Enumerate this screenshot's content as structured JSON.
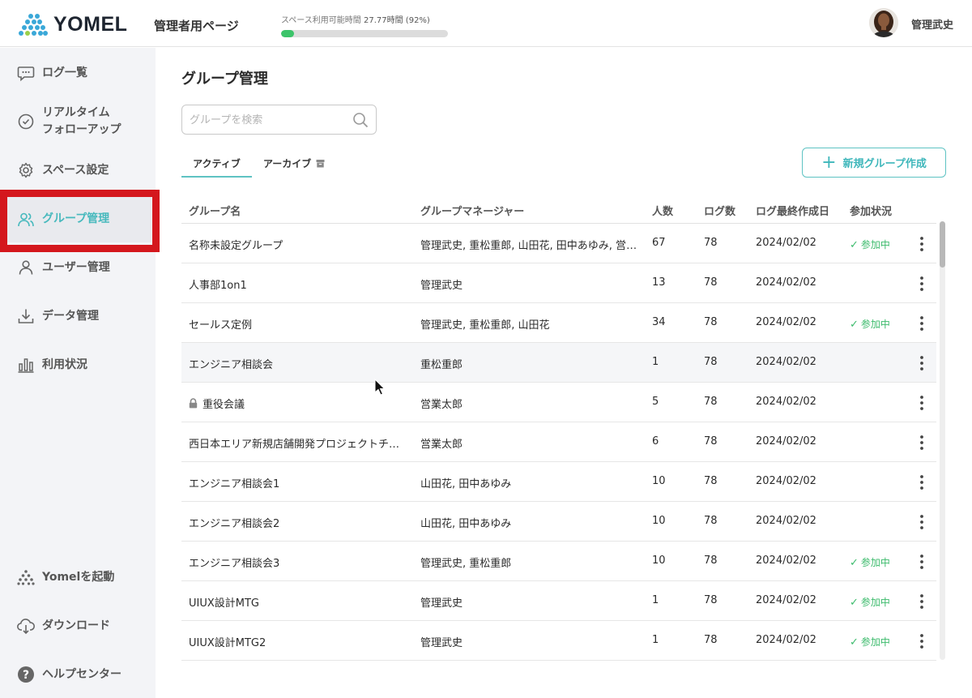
{
  "header": {
    "logo_text": "YOMEL",
    "admin_title": "管理者用ページ",
    "quota_label": "スペース利用可能時間",
    "quota_value": "27.77時間 (92%)",
    "quota_percent": 0.08,
    "user_name": "管理武史"
  },
  "sidebar": {
    "items": [
      {
        "label": "ログ一覧",
        "icon": "chat-bubble-icon"
      },
      {
        "label": "リアルタイム\nフォローアップ",
        "icon": "clock-icon"
      },
      {
        "label": "スペース設定",
        "icon": "gear-icon"
      },
      {
        "label": "グループ管理",
        "icon": "group-icon",
        "active": true
      },
      {
        "label": "ユーザー管理",
        "icon": "user-icon"
      },
      {
        "label": "データ管理",
        "icon": "download-tray-icon"
      },
      {
        "label": "利用状況",
        "icon": "bar-chart-icon"
      }
    ],
    "bottom_items": [
      {
        "label": "Yomelを起動",
        "icon": "yomel-logo-icon"
      },
      {
        "label": "ダウンロード",
        "icon": "cloud-download-icon"
      },
      {
        "label": "ヘルプセンター",
        "icon": "help-icon"
      }
    ]
  },
  "main": {
    "title": "グループ管理",
    "search_placeholder": "グループを検索",
    "tabs": [
      {
        "label": "アクティブ"
      },
      {
        "label": "アーカイブ"
      }
    ],
    "new_group_button": "新規グループ作成",
    "columns": [
      "グループ名",
      "グループマネージャー",
      "人数",
      "ログ数",
      "ログ最終作成日",
      "参加状況"
    ],
    "rows": [
      {
        "name": "名称未設定グループ",
        "managers": "管理武史, 重松重郎, 山田花, 田中あゆみ, 営業太郎",
        "members": "67",
        "logs": "78",
        "last_log": "2024/02/02",
        "status": "参加中"
      },
      {
        "name": "人事部1on1",
        "managers": "管理武史",
        "members": "13",
        "logs": "78",
        "last_log": "2024/02/02",
        "status": ""
      },
      {
        "name": "セールス定例",
        "managers": "管理武史, 重松重郎, 山田花",
        "members": "34",
        "logs": "78",
        "last_log": "2024/02/02",
        "status": "参加中"
      },
      {
        "name": "エンジニア相談会",
        "managers": "重松重郎",
        "members": "1",
        "logs": "78",
        "last_log": "2024/02/02",
        "status": ""
      },
      {
        "name": "重役会議",
        "managers": "営業太郎",
        "members": "5",
        "logs": "78",
        "last_log": "2024/02/02",
        "status": "",
        "locked": true
      },
      {
        "name": "西日本エリア新規店舗開発プロジェクトチーム",
        "managers": "営業太郎",
        "members": "6",
        "logs": "78",
        "last_log": "2024/02/02",
        "status": ""
      },
      {
        "name": "エンジニア相談会1",
        "managers": "山田花, 田中あゆみ",
        "members": "10",
        "logs": "78",
        "last_log": "2024/02/02",
        "status": ""
      },
      {
        "name": "エンジニア相談会2",
        "managers": "山田花, 田中あゆみ",
        "members": "10",
        "logs": "78",
        "last_log": "2024/02/02",
        "status": ""
      },
      {
        "name": "エンジニア相談会3",
        "managers": "管理武史, 重松重郎",
        "members": "10",
        "logs": "78",
        "last_log": "2024/02/02",
        "status": "参加中"
      },
      {
        "name": "UIUX設計MTG",
        "managers": "管理武史",
        "members": "1",
        "logs": "78",
        "last_log": "2024/02/02",
        "status": "参加中"
      },
      {
        "name": "UIUX設計MTG2",
        "managers": "管理武史",
        "members": "1",
        "logs": "78",
        "last_log": "2024/02/02",
        "status": "参加中"
      }
    ]
  },
  "colors": {
    "accent": "#47b9bd",
    "status_green": "#3cbb6c",
    "highlight_red": "#d4171d",
    "sidebar_bg": "#f3f4f7"
  }
}
